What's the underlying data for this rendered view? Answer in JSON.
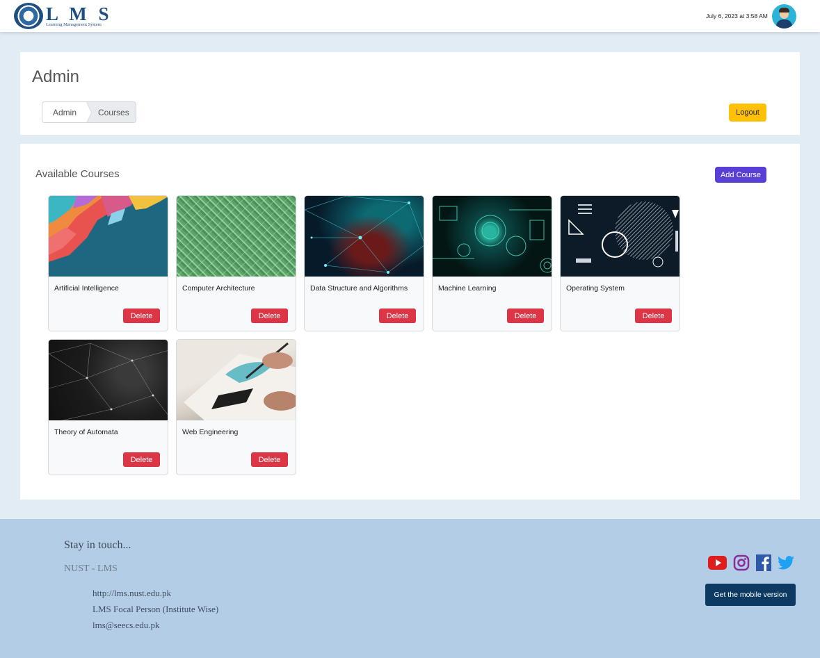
{
  "header": {
    "logo_title": "L M S",
    "logo_subtitle": "Learning Management System",
    "datetime": "July 6, 2023 at 3:58 AM"
  },
  "admin": {
    "title": "Admin",
    "breadcrumb": [
      "Admin",
      "Courses"
    ],
    "logout_label": "Logout"
  },
  "courses": {
    "section_title": "Available Courses",
    "add_label": "Add Course",
    "delete_label": "Delete",
    "items": [
      {
        "title": "Artificial Intelligence"
      },
      {
        "title": "Computer Architecture"
      },
      {
        "title": "Data Structure and Algorithms"
      },
      {
        "title": "Machine Learning"
      },
      {
        "title": "Operating System"
      },
      {
        "title": "Theory of Automata"
      },
      {
        "title": "Web Engineering"
      }
    ]
  },
  "footer": {
    "heading": "Stay in touch...",
    "org": "NUST - LMS",
    "links": [
      "http://lms.nust.edu.pk",
      "LMS Focal Person (Institute Wise)",
      "lms@seecs.edu.pk"
    ],
    "mobile_label": "Get the mobile version",
    "social_icons": [
      "youtube-icon",
      "instagram-icon",
      "facebook-icon",
      "twitter-icon"
    ]
  },
  "colors": {
    "brand": "#1e4f80",
    "logout": "#ffc107",
    "add_course": "#5a3fd6",
    "delete": "#dc3545",
    "footer_bg": "#b4cde6",
    "mobile_button": "#0d3a63"
  }
}
